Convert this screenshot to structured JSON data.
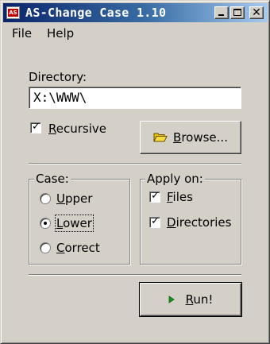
{
  "window": {
    "title": "AS-Change Case 1.10",
    "icon_text": "AS"
  },
  "menu": {
    "file": "File",
    "help": "Help"
  },
  "directory": {
    "label": "Directory:",
    "value": "X:\\WWW\\"
  },
  "recursive": {
    "label_first": "R",
    "label_rest": "ecursive",
    "checked": true
  },
  "browse_button": {
    "label_first": "B",
    "label_rest": "rowse..."
  },
  "case_group": {
    "title": "Case:",
    "options": [
      {
        "first": "U",
        "rest": "pper",
        "selected": false
      },
      {
        "first": "L",
        "rest": "ower",
        "selected": true
      },
      {
        "first": "C",
        "rest": "orrect",
        "selected": false
      }
    ]
  },
  "apply_group": {
    "title": "Apply on:",
    "options": [
      {
        "first": "F",
        "rest": "iles",
        "checked": true
      },
      {
        "first": "D",
        "rest": "irectories",
        "checked": true
      }
    ]
  },
  "run_button": {
    "label_first": "R",
    "label_rest": "un!"
  },
  "colors": {
    "face": "#d4d0c8",
    "title_start": "#0a246a",
    "title_end": "#a6caf0",
    "folder": "#e8c000",
    "run_arrow": "#1a9a1a"
  }
}
